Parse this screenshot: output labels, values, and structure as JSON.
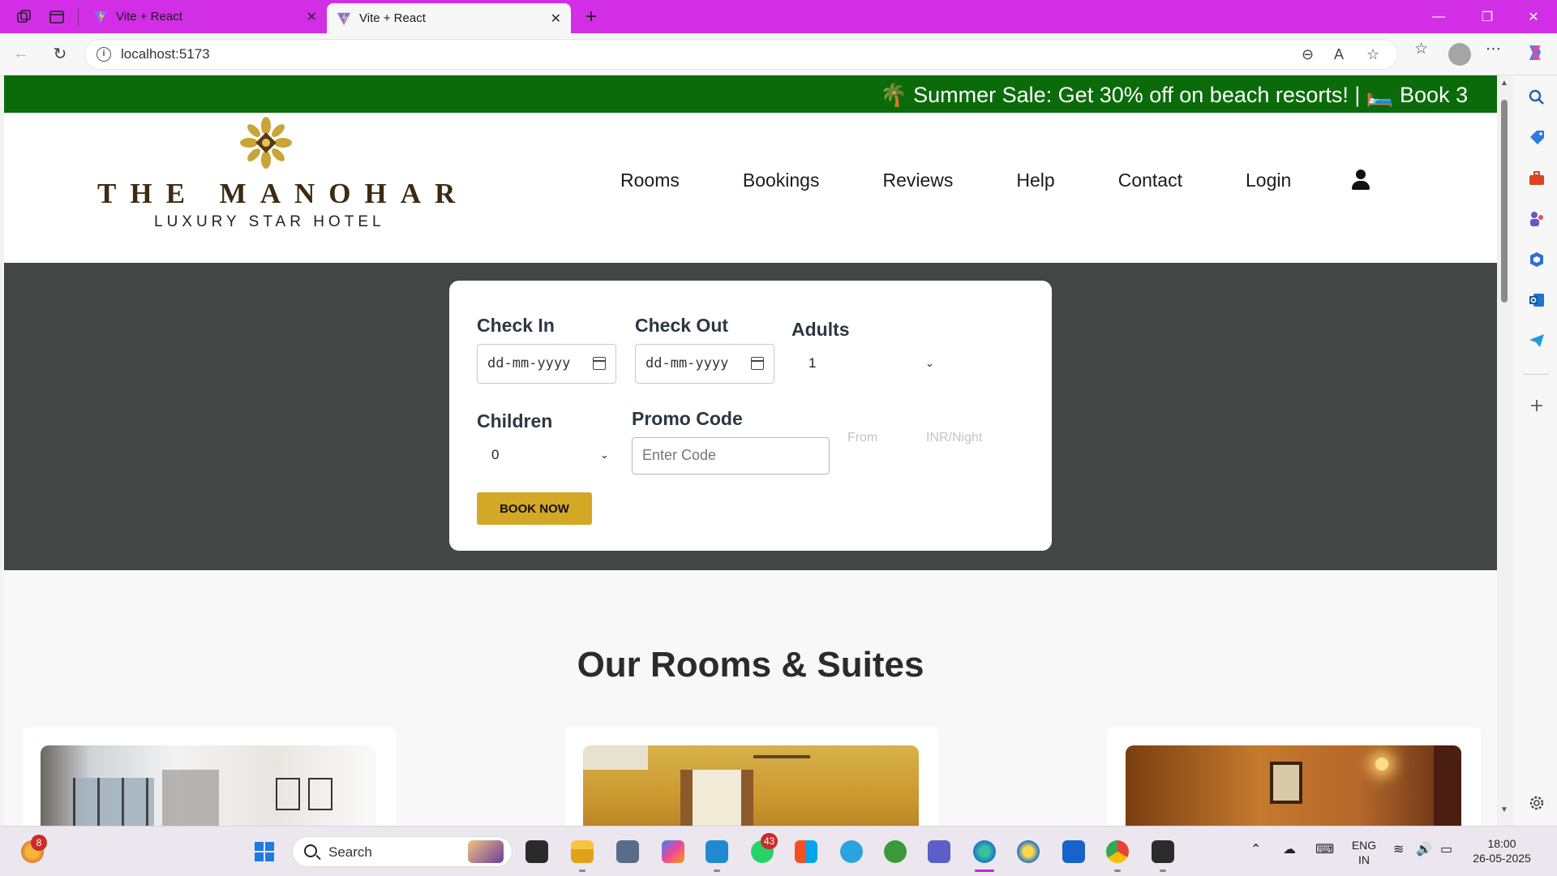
{
  "browser": {
    "tabs": [
      {
        "title": "Vite + React",
        "active": false
      },
      {
        "title": "Vite + React",
        "active": true
      }
    ],
    "url": "localhost:5173"
  },
  "site": {
    "promo_banner": "🌴 Summer Sale: Get 30% off on beach resorts!   |   🛏️ Book 3",
    "logo_title": "THE MANOHAR",
    "logo_subtitle": "LUXURY STAR HOTEL",
    "nav": [
      "Rooms",
      "Bookings",
      "Reviews",
      "Help",
      "Contact",
      "Login"
    ]
  },
  "booking": {
    "check_in_label": "Check In",
    "check_in_value": "dd-mm-yyyy",
    "check_out_label": "Check Out",
    "check_out_value": "dd-mm-yyyy",
    "adults_label": "Adults",
    "adults_value": "1",
    "children_label": "Children",
    "children_value": "0",
    "promo_label": "Promo Code",
    "promo_placeholder": "Enter Code",
    "from_label": "From",
    "price_unit": "INR/Night",
    "book_button": "BOOK NOW"
  },
  "rooms_section": {
    "title": "Our Rooms & Suites"
  },
  "taskbar": {
    "search_placeholder": "Search",
    "weather_badge": "8",
    "whatsapp_badge": "43",
    "lang_line1": "ENG",
    "lang_line2": "IN",
    "time": "18:00",
    "date": "26-05-2025"
  },
  "colors": {
    "tab_bar": "#d12ee6",
    "promo_bg": "#0b6b0b",
    "hero_bg": "#444646",
    "book_button": "#d4a827"
  }
}
